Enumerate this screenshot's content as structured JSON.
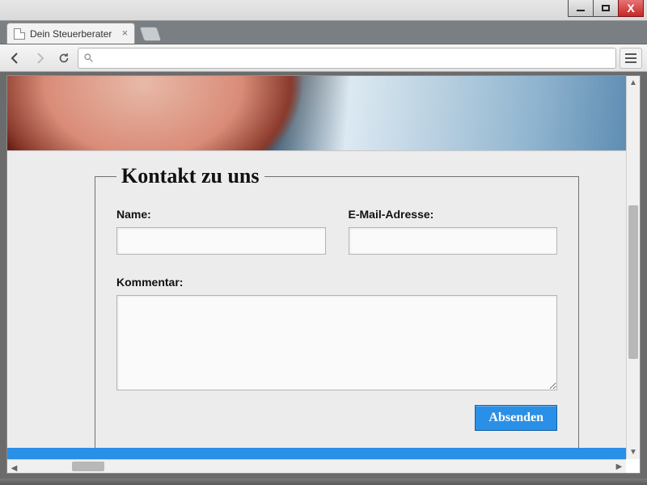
{
  "browser": {
    "tab_title": "Dein Steuerberater"
  },
  "form": {
    "legend": "Kontakt zu uns",
    "name_label": "Name:",
    "email_label": "E-Mail-Adresse:",
    "comment_label": "Kommentar:",
    "name_value": "",
    "email_value": "",
    "comment_value": "",
    "submit_label": "Absenden"
  }
}
